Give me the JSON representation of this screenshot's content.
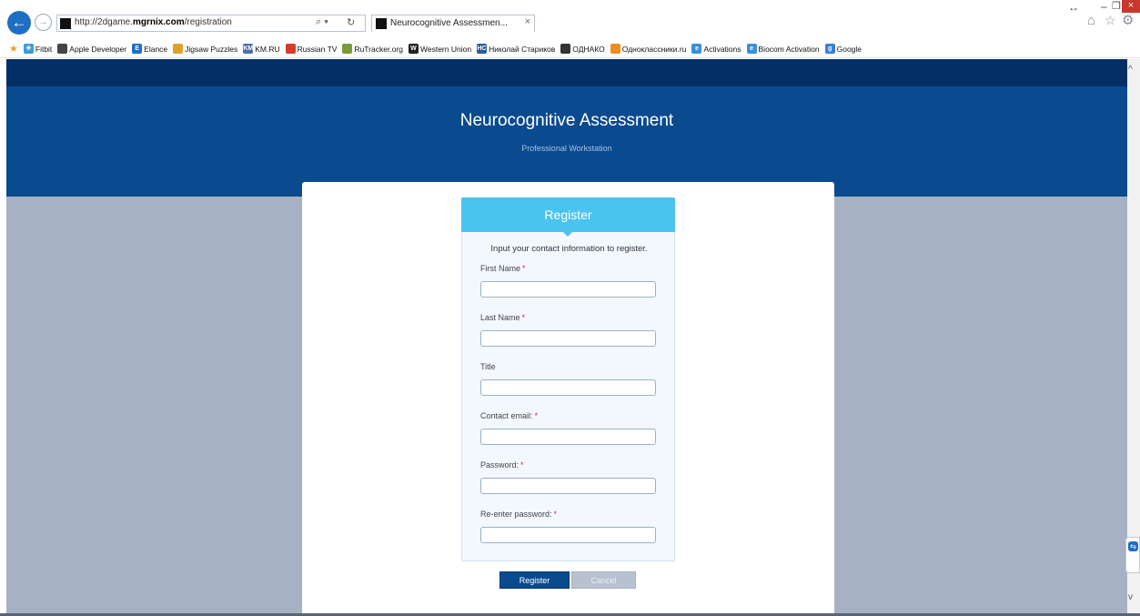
{
  "browser": {
    "url_prefix": "http://2dgame.",
    "url_domain": "mgrnix.com",
    "url_path": "/registration",
    "tab_title": "Neurocognitive Assessmen...",
    "tab_close": "×",
    "search_glyph": "⌕ ▾",
    "refresh_glyph": "↻",
    "favorites": [
      {
        "label": "Fitbit",
        "icon": "fitbit-icon",
        "color": "#3a9bd6",
        "glyph": "⁜"
      },
      {
        "label": "Apple Developer",
        "icon": "apple-icon",
        "color": "#444444",
        "glyph": ""
      },
      {
        "label": "Elance",
        "icon": "elance-icon",
        "color": "#1e6fc4",
        "glyph": "E"
      },
      {
        "label": "Jigsaw Puzzles",
        "icon": "jigsaw-icon",
        "color": "#e0a32a",
        "glyph": ""
      },
      {
        "label": "KM.RU",
        "icon": "kmru-icon",
        "color": "#4a6ea8",
        "glyph": "KM"
      },
      {
        "label": "Russian TV",
        "icon": "russiantv-icon",
        "color": "#d43b2a",
        "glyph": ""
      },
      {
        "label": "RuTracker.org",
        "icon": "rutracker-icon",
        "color": "#7a9a3a",
        "glyph": ""
      },
      {
        "label": "Western Union",
        "icon": "westernunion-icon",
        "color": "#222222",
        "glyph": "W"
      },
      {
        "label": "Николай Стариков",
        "icon": "nc-icon",
        "color": "#2a5a9a",
        "glyph": "НС"
      },
      {
        "label": "ОДНАКО",
        "icon": "odnako-icon",
        "color": "#333333",
        "glyph": ""
      },
      {
        "label": "Одноклассники.ru",
        "icon": "odnoklassniki-icon",
        "color": "#f28c1e",
        "glyph": ""
      },
      {
        "label": "Activations",
        "icon": "ie-icon",
        "color": "#3a8fd6",
        "glyph": "e"
      },
      {
        "label": "Biocom Activation",
        "icon": "ie-icon",
        "color": "#3a8fd6",
        "glyph": "e"
      },
      {
        "label": "Google",
        "icon": "google-icon",
        "color": "#3a7fd6",
        "glyph": "g"
      }
    ]
  },
  "header": {
    "title": "Neurocognitive Assessment",
    "subtitle": "Professional Workstation"
  },
  "form": {
    "heading": "Register",
    "intro": "Input your contact information to register.",
    "required_mark": "*",
    "fields": [
      {
        "label": "First Name",
        "required": true,
        "value": ""
      },
      {
        "label": "Last Name",
        "required": true,
        "value": ""
      },
      {
        "label": "Title",
        "required": false,
        "value": ""
      },
      {
        "label": "Contact email:",
        "required": true,
        "value": ""
      },
      {
        "label": "Password:",
        "required": true,
        "value": ""
      },
      {
        "label": "Re-enter password:",
        "required": true,
        "value": ""
      }
    ],
    "register_label": "Register",
    "cancel_label": "Cancel"
  },
  "colors": {
    "header_band": "#0a4a8f",
    "top_strip": "#032f66",
    "page_background": "#a7b1c4",
    "form_head": "#4bc3ef",
    "required": "#e0263c"
  }
}
